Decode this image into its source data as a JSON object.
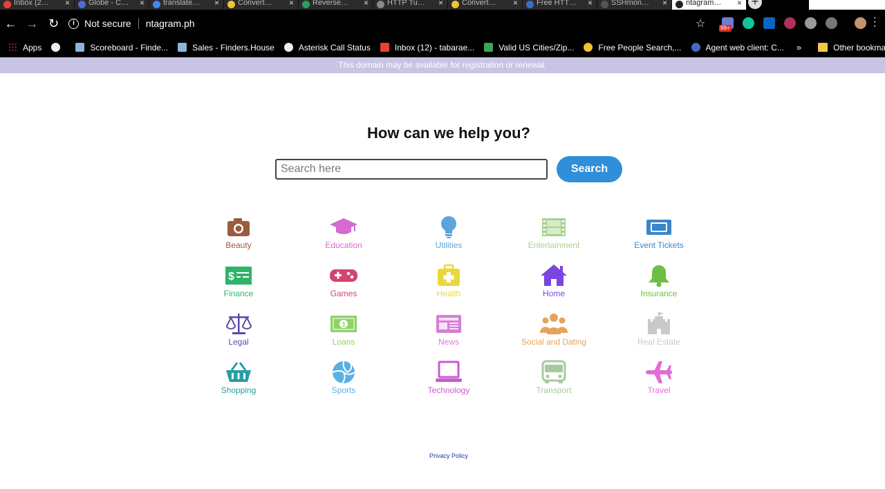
{
  "browser": {
    "tabs": [
      {
        "label": "Inbox (2…",
        "color": "#e94235"
      },
      {
        "label": "Globe - C…",
        "color": "#4a6fd8"
      },
      {
        "label": "translate…",
        "color": "#4285f4"
      },
      {
        "label": "Convert…",
        "color": "#f1c232"
      },
      {
        "label": "Reverse…",
        "color": "#2e9e5b"
      },
      {
        "label": "HTTP Tu…",
        "color": "#888888"
      },
      {
        "label": "Convert…",
        "color": "#f1c232"
      },
      {
        "label": "Free HTT…",
        "color": "#3b6cc7"
      },
      {
        "label": "SSHmon…",
        "color": "#555555"
      },
      {
        "label": "ntagram…",
        "color": "#ffffff",
        "active": true
      }
    ],
    "address": {
      "security_label": "Not secure",
      "url": "ntagram.ph"
    },
    "extension_badge": "99+",
    "bookmarks": [
      {
        "label": "Apps",
        "icon": "apps-grid-icon"
      },
      {
        "label": "",
        "icon": "globe-icon"
      },
      {
        "label": "Scoreboard - Finde...",
        "icon": "finders-icon"
      },
      {
        "label": "Sales - Finders.House",
        "icon": "finders-icon"
      },
      {
        "label": "Asterisk Call Status",
        "icon": "globe-icon"
      },
      {
        "label": "Inbox (12) - tabarae...",
        "icon": "gmail-icon"
      },
      {
        "label": "Valid US Cities/Zip...",
        "icon": "sheet-icon"
      },
      {
        "label": "Free People Search,...",
        "icon": "search-site-icon"
      },
      {
        "label": "Agent web client: C...",
        "icon": "agent-icon"
      }
    ],
    "bookmarks_overflow": "»",
    "other_bookmarks": "Other bookmarks"
  },
  "banner": {
    "text": "This domain may be available for registration or renewal."
  },
  "page": {
    "heading": "How can we help you?",
    "search_placeholder": "Search here",
    "search_button": "Search",
    "privacy_link": "Privacy Policy"
  },
  "categories": [
    {
      "label": "Beauty",
      "icon": "camera-icon",
      "color": "#9a5b3f"
    },
    {
      "label": "Education",
      "icon": "graduation-cap-icon",
      "color": "#d46ad1"
    },
    {
      "label": "Utilities",
      "icon": "lightbulb-icon",
      "color": "#5aa5dc"
    },
    {
      "label": "Entertainment",
      "icon": "film-icon",
      "color": "#a9d18e"
    },
    {
      "label": "Event Tickets",
      "icon": "ticket-icon",
      "color": "#3a86c8"
    },
    {
      "label": "Finance",
      "icon": "money-icon",
      "color": "#2fb36a"
    },
    {
      "label": "Games",
      "icon": "gamepad-icon",
      "color": "#d1456f"
    },
    {
      "label": "Health",
      "icon": "medkit-icon",
      "color": "#e9d83a"
    },
    {
      "label": "Home",
      "icon": "house-icon",
      "color": "#7a45e0"
    },
    {
      "label": "Insurance",
      "icon": "bell-icon",
      "color": "#6cbf43"
    },
    {
      "label": "Legal",
      "icon": "scales-icon",
      "color": "#5a4aa8"
    },
    {
      "label": "Loans",
      "icon": "banknote-icon",
      "color": "#8ed26a"
    },
    {
      "label": "News",
      "icon": "newspaper-icon",
      "color": "#d77ed6"
    },
    {
      "label": "Social and Dating",
      "icon": "people-icon",
      "color": "#e6a45a"
    },
    {
      "label": "Real Estate",
      "icon": "castle-icon",
      "color": "#c9c9c9"
    },
    {
      "label": "Shopping",
      "icon": "basket-icon",
      "color": "#2a9da0"
    },
    {
      "label": "Sports",
      "icon": "volleyball-icon",
      "color": "#5ab0e3"
    },
    {
      "label": "Technology",
      "icon": "laptop-icon",
      "color": "#c95ad2"
    },
    {
      "label": "Transport",
      "icon": "bus-icon",
      "color": "#a7c9a0"
    },
    {
      "label": "Travel",
      "icon": "plane-icon",
      "color": "#e46bd8"
    }
  ]
}
